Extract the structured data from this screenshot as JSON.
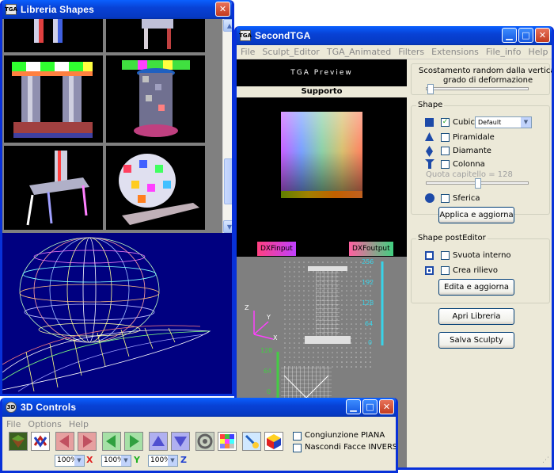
{
  "library_window": {
    "title": "Libreria Shapes"
  },
  "tga_window": {
    "title": "SecondTGA",
    "menu": [
      "File",
      "Sculpt_Editor",
      "TGA_Animated",
      "Filters",
      "Extensions",
      "File_info",
      "Help"
    ],
    "preview_title": "TGA Preview",
    "supporto_label": "Supporto",
    "dx_input_label": "DXFinput",
    "dx_output_label": "DXFoutput",
    "axis_top": [
      "256",
      "192",
      "128",
      "64",
      "0"
    ],
    "axis_left": [
      "128",
      "64",
      "0"
    ],
    "axis_letters": {
      "z": "Z",
      "y": "Y",
      "x": "X"
    },
    "random_group": {
      "line1": "Scostamento random dalla verticale",
      "line2": "grado di deformazione"
    },
    "shape_group": {
      "label": "Shape",
      "cubica": "Cubica",
      "cubica_checked": true,
      "dropdown_value": "Default",
      "piramidale": "Piramidale",
      "diamante": "Diamante",
      "colonna": "Colonna",
      "quota_capitello": "Quota capitello = 128",
      "sferica": "Sferica",
      "apply_button": "Applica e aggiorna"
    },
    "posteditor_group": {
      "label": "Shape postEditor",
      "svuota": "Svuota interno",
      "crea": "Crea rilievo",
      "edit_button": "Edita e aggiorna"
    },
    "apri_button": "Apri Libreria",
    "salva_button": "Salva Sculpty"
  },
  "controls_window": {
    "title": "3D Controls",
    "menu": [
      "File",
      "Options",
      "Help"
    ],
    "congiunzione": "Congiunzione PIANA",
    "nascondi": "Nascondi Facce INVERSE",
    "zoom_x": {
      "value": "100%",
      "axis": "X"
    },
    "zoom_y": {
      "value": "100%",
      "axis": "Y"
    },
    "zoom_z": {
      "value": "100%",
      "axis": "Z"
    }
  },
  "colors": {
    "title_blue": "#0842d6",
    "wire_bg": "#000080",
    "accent_cyan": "#39d3e8",
    "accent_green": "#44cc44"
  }
}
